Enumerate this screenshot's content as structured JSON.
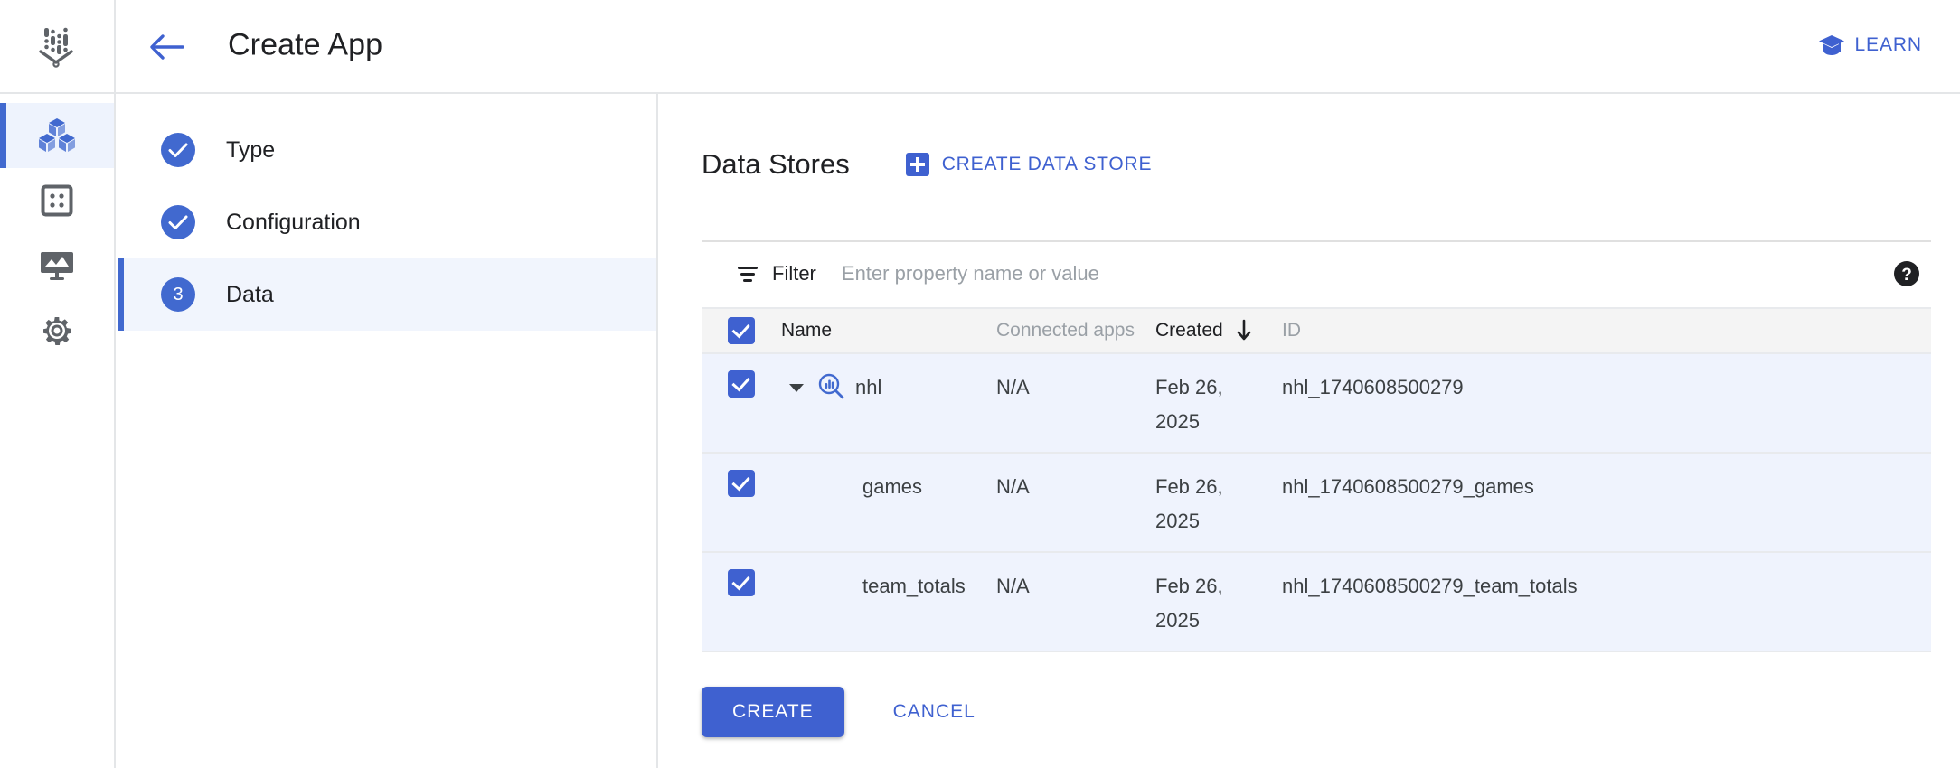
{
  "app": {
    "logo_icon": "vertex-ai-agent-builder-icon",
    "title": "Create App"
  },
  "header": {
    "back_icon": "back-arrow-icon",
    "learn_icon": "graduation-cap-icon",
    "learn_label": "LEARN"
  },
  "rail": {
    "items": [
      {
        "icon": "cubes-apps-icon",
        "active": true
      },
      {
        "icon": "data-store-grid-icon",
        "active": false
      },
      {
        "icon": "analytics-monitor-icon",
        "active": false
      },
      {
        "icon": "gear-settings-icon",
        "active": false
      }
    ]
  },
  "stepper": {
    "steps": [
      {
        "label": "Type",
        "state": "complete",
        "badge": "✓"
      },
      {
        "label": "Configuration",
        "state": "complete",
        "badge": "✓"
      },
      {
        "label": "Data",
        "state": "active",
        "badge": "3"
      }
    ]
  },
  "main": {
    "section_title": "Data Stores",
    "create_data_store_label": "CREATE DATA STORE",
    "create_data_store_icon": "plus-square-icon",
    "filter": {
      "icon": "filter-icon",
      "label": "Filter",
      "value": "",
      "placeholder": "Enter property name or value"
    },
    "help_icon": "help-circle-icon",
    "table": {
      "columns": [
        {
          "key": "name",
          "label": "Name",
          "emphasis": true
        },
        {
          "key": "connected_apps",
          "label": "Connected apps",
          "emphasis": false
        },
        {
          "key": "created",
          "label": "Created",
          "emphasis": true,
          "sort": "desc"
        },
        {
          "key": "id",
          "label": "ID",
          "emphasis": false
        }
      ],
      "select_all_checked": true,
      "rows": [
        {
          "name": "nhl",
          "connected_apps": "N/A",
          "created": "Feb 26, 2025",
          "id": "nhl_1740608500279",
          "checked": true,
          "child": false,
          "expanded": true,
          "icon": "search-data-store-icon"
        },
        {
          "name": "games",
          "connected_apps": "N/A",
          "created": "Feb 26, 2025",
          "id": "nhl_1740608500279_games",
          "checked": true,
          "child": true,
          "expanded": false,
          "icon": ""
        },
        {
          "name": "team_totals",
          "connected_apps": "N/A",
          "created": "Feb 26, 2025",
          "id": "nhl_1740608500279_team_totals",
          "checked": true,
          "child": true,
          "expanded": false,
          "icon": ""
        }
      ]
    },
    "footer": {
      "create_label": "CREATE",
      "cancel_label": "CANCEL"
    }
  },
  "colors": {
    "accent": "#3f61d0",
    "rail_active_bg": "#eef3fd",
    "row_selected_bg": "#eff3fd",
    "header_bg": "#f4f4f4",
    "border": "#e4e6e8"
  }
}
